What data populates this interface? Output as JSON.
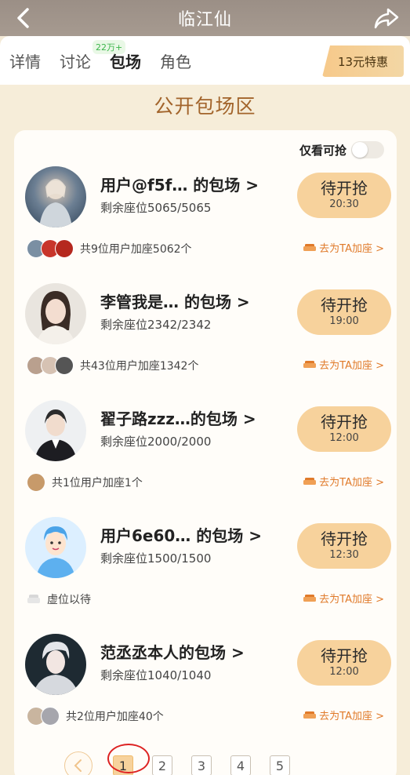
{
  "header": {
    "title": "临江仙"
  },
  "tabs": [
    {
      "label": "详情"
    },
    {
      "label": "讨论",
      "badge": "22万+"
    },
    {
      "label": "包场"
    },
    {
      "label": "角色"
    }
  ],
  "special_offer": "13元特惠",
  "section_title": "公开包场区",
  "filter": {
    "label": "仅看可抢",
    "on": false
  },
  "entries": [
    {
      "name": "用户@f5f…  的包场 >",
      "seats": "剩余座位5065/5065",
      "status": "待开抢",
      "time": "20:30",
      "joined": "共9位用户加座5062个",
      "join_link": "去为TA加座 >"
    },
    {
      "name": "李管我是…  的包场 >",
      "seats": "剩余座位2342/2342",
      "status": "待开抢",
      "time": "19:00",
      "joined": "共43位用户加座1342个",
      "join_link": "去为TA加座 >"
    },
    {
      "name": "翟子路zzz…的包场 >",
      "seats": "剩余座位2000/2000",
      "status": "待开抢",
      "time": "12:00",
      "joined": "共1位用户加座1个",
      "join_link": "去为TA加座 >"
    },
    {
      "name": "用户6e60…  的包场 >",
      "seats": "剩余座位1500/1500",
      "status": "待开抢",
      "time": "12:30",
      "joined": "虚位以待",
      "join_link": "去为TA加座 >"
    },
    {
      "name": "范丞丞本人的包场 >",
      "seats": "剩余座位1040/1040",
      "status": "待开抢",
      "time": "12:00",
      "joined": "共2位用户加座40个",
      "join_link": "去为TA加座 >"
    }
  ],
  "pagination": {
    "pages": [
      "1",
      "2",
      "3",
      "4",
      "5"
    ],
    "current": "1"
  },
  "colors": {
    "accent": "#f7d29c",
    "brand": "#a2642b",
    "link": "#e07a2a"
  }
}
